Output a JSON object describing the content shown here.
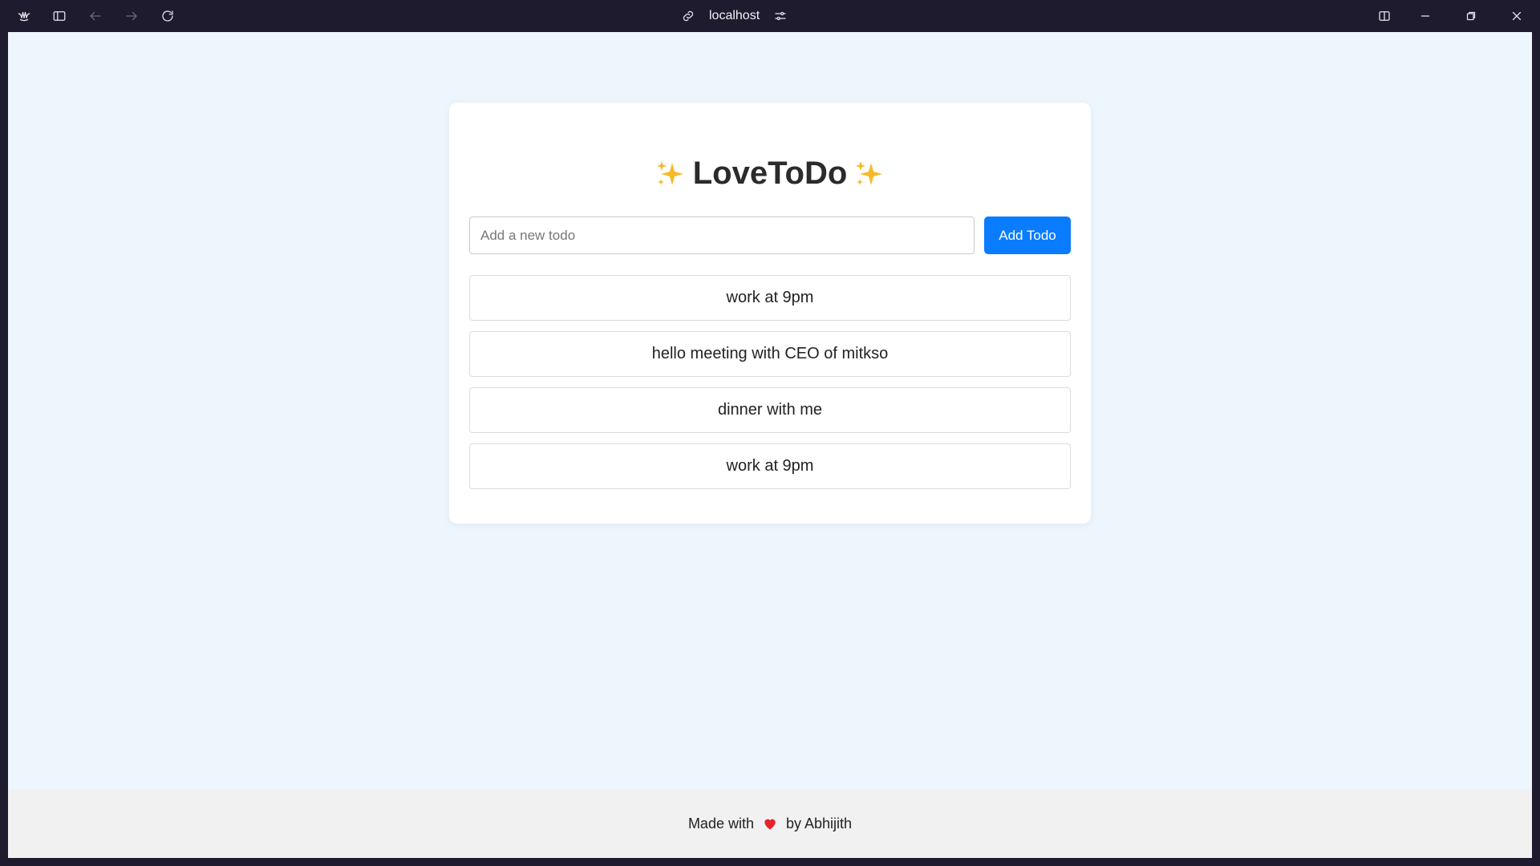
{
  "browser": {
    "address": "localhost",
    "icons": {
      "logo": "browser-logo-icon",
      "sidebar": "sidebar-toggle-icon",
      "back": "back-arrow-icon",
      "forward": "forward-arrow-icon",
      "reload": "reload-icon",
      "link": "link-icon",
      "site_settings": "sliders-icon",
      "split_view": "split-view-icon",
      "minimize": "minimize-icon",
      "restore": "restore-icon",
      "close": "close-icon"
    }
  },
  "app": {
    "title": "LoveToDo",
    "input_placeholder": "Add a new todo",
    "input_value": "",
    "add_button_label": "Add Todo",
    "accent_color": "#0a7cff",
    "todos": [
      "work at 9pm",
      "hello meeting with CEO of mitkso",
      "dinner with me",
      "work at 9pm"
    ]
  },
  "footer": {
    "prefix": "Made with",
    "suffix": "by Abhijith"
  }
}
